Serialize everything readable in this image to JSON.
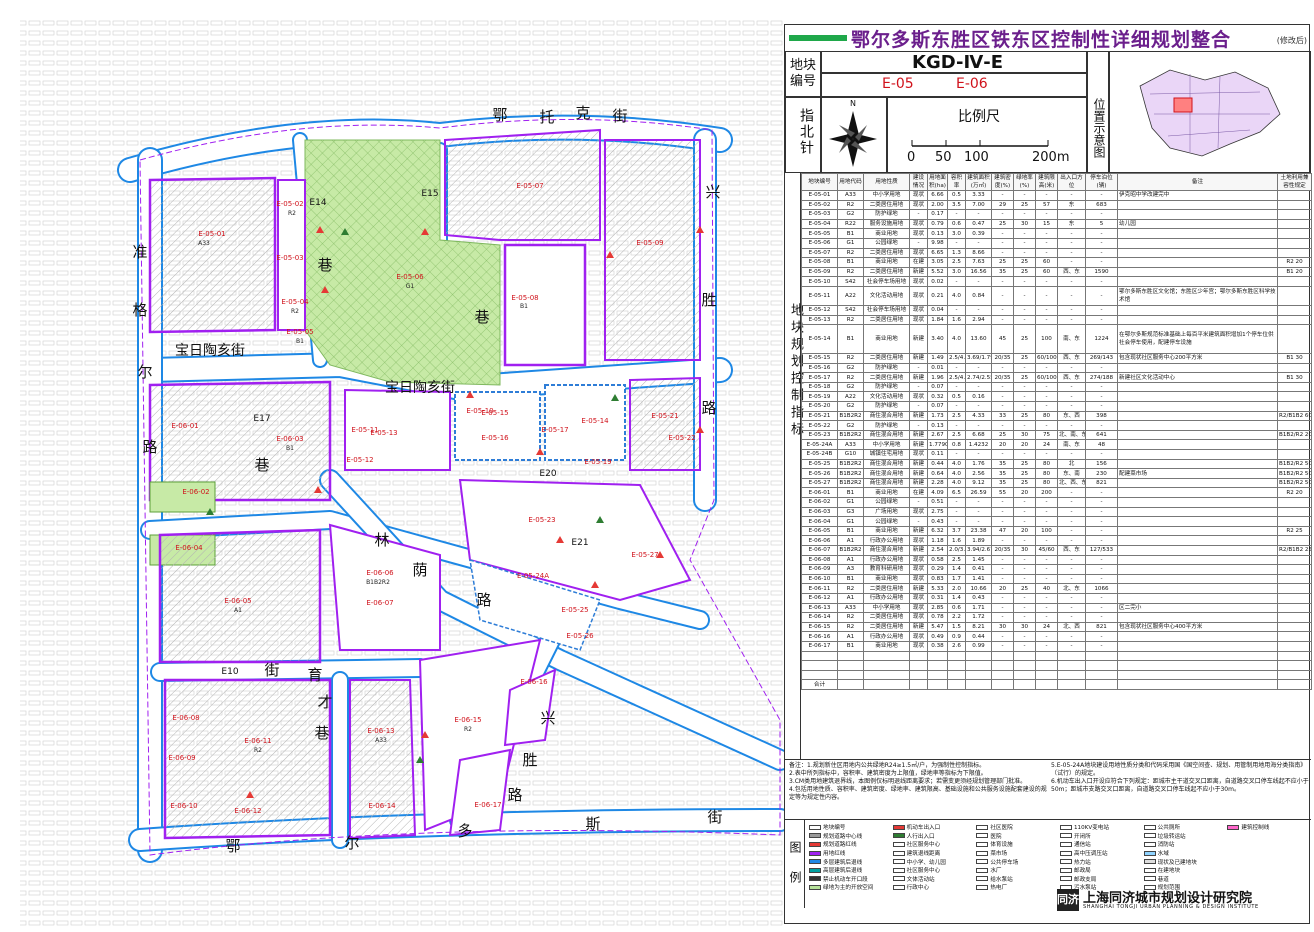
{
  "title": "鄂尔多斯东胜区铁东区控制性详细规划整合",
  "title_note": "(修改后)",
  "block_label": "地块编号",
  "plan_code": "KGD-Ⅳ-E",
  "block_codes": [
    "E-05",
    "E-06"
  ],
  "north_label": "指北针",
  "north_letter": "N",
  "scale_label": "比例尺",
  "scale_ticks": [
    "0",
    "50",
    "100",
    "200m"
  ],
  "location_label": "位置示意图",
  "side_label": "地块规划控制指标",
  "table": {
    "headers": [
      "地块编号",
      "用地代码",
      "用地性质",
      "建设情况",
      "用地面积(ha)",
      "容积率",
      "建筑面积(万㎡)",
      "建筑密度(%)",
      "绿地率(%)",
      "建筑限高(米)",
      "出入口方位",
      "停车泊位(辆)",
      "备注",
      "土地利用兼容性规定"
    ],
    "rows": [
      [
        "E-05-01",
        "A33",
        "中小学用地",
        "现状",
        "6.66",
        "0.5",
        "3.33",
        "-",
        "-",
        "-",
        "-",
        "-",
        "伊克昭中学改建完中",
        ""
      ],
      [
        "E-05-02",
        "R2",
        "二类居住用地",
        "现状",
        "2.00",
        "3.5",
        "7.00",
        "29",
        "25",
        "57",
        "东",
        "683",
        "",
        ""
      ],
      [
        "E-05-03",
        "G2",
        "防护绿地",
        "-",
        "0.17",
        "-",
        "-",
        "-",
        "-",
        "-",
        "-",
        "-",
        "",
        ""
      ],
      [
        "E-05-04",
        "R22",
        "服务设施用地",
        "现状",
        "0.79",
        "0.6",
        "0.47",
        "25",
        "30",
        "15",
        "东",
        "5",
        "幼儿园",
        ""
      ],
      [
        "E-05-05",
        "B1",
        "商业用地",
        "现状",
        "0.13",
        "3.0",
        "0.39",
        "-",
        "-",
        "-",
        "-",
        "-",
        "",
        ""
      ],
      [
        "E-05-06",
        "G1",
        "公园绿地",
        "-",
        "9.98",
        "-",
        "-",
        "-",
        "-",
        "-",
        "-",
        "-",
        "",
        ""
      ],
      [
        "E-05-07",
        "R2",
        "二类居住用地",
        "现状",
        "6.65",
        "1.3",
        "8.66",
        "-",
        "-",
        "-",
        "-",
        "-",
        "",
        ""
      ],
      [
        "E-05-08",
        "B1",
        "商业用地",
        "在建",
        "3.05",
        "2.5",
        "7.63",
        "25",
        "25",
        "60",
        "-",
        "-",
        "",
        "R2 20"
      ],
      [
        "E-05-09",
        "R2",
        "二类居住用地",
        "新建",
        "5.52",
        "3.0",
        "16.56",
        "35",
        "25",
        "60",
        "西、东",
        "1590",
        "",
        "B1 20"
      ],
      [
        "E-05-10",
        "S42",
        "社会停车场用地",
        "现状",
        "0.02",
        "-",
        "-",
        "-",
        "-",
        "-",
        "-",
        "-",
        "",
        ""
      ],
      [
        "E-05-11",
        "A22",
        "文化活动用地",
        "现状",
        "0.21",
        "4.0",
        "0.84",
        "-",
        "-",
        "-",
        "-",
        "-",
        "鄂尔多斯东胜区文化馆；东胜区少年宫；鄂尔多斯东胜区科学技术馆",
        ""
      ],
      [
        "E-05-12",
        "S42",
        "社会停车场用地",
        "现状",
        "0.04",
        "-",
        "-",
        "-",
        "-",
        "-",
        "-",
        "-",
        "",
        ""
      ],
      [
        "E-05-13",
        "R2",
        "二类居住用地",
        "现状",
        "1.84",
        "1.6",
        "2.94",
        "-",
        "-",
        "-",
        "-",
        "-",
        "",
        ""
      ],
      [
        "E-05-14",
        "B1",
        "商业用地",
        "新建",
        "3.40",
        "4.0",
        "13.60",
        "45",
        "25",
        "100",
        "南、东",
        "1224",
        "在鄂尔多斯规范标准基础上每百平米建筑面积增加1个停车位供社会停车使用，配建停车设施",
        ""
      ],
      [
        "E-05-15",
        "R2",
        "二类居住用地",
        "新建",
        "1.49",
        "2.5/4.0",
        "3.69/1.79",
        "20/35",
        "25",
        "60/100",
        "西、东",
        "269/143",
        "包含现状社区服务中心200平方米",
        "B1 30"
      ],
      [
        "E-05-16",
        "G2",
        "防护绿地",
        "-",
        "0.01",
        "-",
        "-",
        "-",
        "-",
        "-",
        "-",
        "-",
        "",
        ""
      ],
      [
        "E-05-17",
        "R2",
        "二类居住用地",
        "新建",
        "1.96",
        "2.5/4.0",
        "2.74/2.55",
        "20/35",
        "25",
        "60/100",
        "西、东",
        "274/188",
        "新建社区文化活动中心",
        "B1 30"
      ],
      [
        "E-05-18",
        "G2",
        "防护绿地",
        "-",
        "0.07",
        "-",
        "-",
        "-",
        "-",
        "-",
        "-",
        "-",
        "",
        ""
      ],
      [
        "E-05-19",
        "A22",
        "文化活动用地",
        "现状",
        "0.32",
        "0.5",
        "0.16",
        "-",
        "-",
        "-",
        "-",
        "-",
        "",
        ""
      ],
      [
        "E-05-20",
        "G2",
        "防护绿地",
        "-",
        "0.07",
        "-",
        "-",
        "-",
        "-",
        "-",
        "-",
        "-",
        "",
        ""
      ],
      [
        "E-05-21",
        "B1B2R2",
        "商住混合用地",
        "新建",
        "1.73",
        "2.5",
        "4.33",
        "33",
        "25",
        "80",
        "东、西",
        "398",
        "",
        "R2/B1B2 60/40"
      ],
      [
        "E-05-22",
        "G2",
        "防护绿地",
        "-",
        "0.13",
        "-",
        "-",
        "-",
        "-",
        "-",
        "-",
        "-",
        "",
        ""
      ],
      [
        "E-05-23",
        "B1B2R2",
        "商住混合用地",
        "新建",
        "2.67",
        "2.5",
        "6.68",
        "25",
        "30",
        "75",
        "北、南、东",
        "641",
        "",
        "B1B2/R2 20/80"
      ],
      [
        "E-05-24A",
        "A33",
        "中小学用地",
        "新建",
        "1.7790",
        "0.8",
        "1.4232",
        "20",
        "20",
        "24",
        "南、东",
        "48",
        "",
        ""
      ],
      [
        "E-05-24B",
        "G10",
        "城镇住宅用地",
        "现状",
        "0.11",
        "-",
        "-",
        "-",
        "-",
        "-",
        "-",
        "-",
        "",
        ""
      ],
      [
        "E-05-25",
        "B1B2R2",
        "商住混合用地",
        "新建",
        "0.44",
        "4.0",
        "1.76",
        "35",
        "25",
        "80",
        "北",
        "156",
        "",
        "B1B2/R2 50/50"
      ],
      [
        "E-05-26",
        "B1B2R2",
        "商住混合用地",
        "新建",
        "0.64",
        "4.0",
        "2.56",
        "35",
        "25",
        "80",
        "东、南",
        "230",
        "配建菜市场",
        "B1B2/R2 50/50"
      ],
      [
        "E-05-27",
        "B1B2R2",
        "商住混合用地",
        "新建",
        "2.28",
        "4.0",
        "9.12",
        "35",
        "25",
        "80",
        "北、西、东",
        "821",
        "",
        "B1B2/R2 50/50"
      ],
      [
        "E-06-01",
        "B1",
        "商业用地",
        "在建",
        "4.09",
        "6.5",
        "26.59",
        "55",
        "20",
        "200",
        "-",
        "-",
        "",
        "R2 20"
      ],
      [
        "E-06-02",
        "G1",
        "公园绿地",
        "-",
        "0.51",
        "-",
        "-",
        "-",
        "-",
        "-",
        "-",
        "-",
        "",
        ""
      ],
      [
        "E-06-03",
        "G3",
        "广场用地",
        "现状",
        "2.75",
        "-",
        "-",
        "-",
        "-",
        "-",
        "-",
        "-",
        "",
        ""
      ],
      [
        "E-06-04",
        "G1",
        "公园绿地",
        "-",
        "0.43",
        "-",
        "-",
        "-",
        "-",
        "-",
        "-",
        "-",
        "",
        ""
      ],
      [
        "E-06-05",
        "B1",
        "商业用地",
        "新建",
        "6.32",
        "3.7",
        "23.38",
        "47",
        "20",
        "100",
        "-",
        "-",
        "",
        "R2 25"
      ],
      [
        "E-06-06",
        "A1",
        "行政办公用地",
        "现状",
        "1.18",
        "1.6",
        "1.89",
        "-",
        "-",
        "-",
        "-",
        "-",
        "",
        ""
      ],
      [
        "E-06-07",
        "B1B2R2",
        "商住混合用地",
        "新建",
        "2.54",
        "2.0/3.0",
        "3.94/2.67",
        "20/35",
        "30",
        "45/60",
        "西、东",
        "127/533",
        "",
        "R2/B1B2 25/75"
      ],
      [
        "E-06-08",
        "A1",
        "行政办公用地",
        "现状",
        "0.58",
        "2.5",
        "1.45",
        "-",
        "-",
        "-",
        "-",
        "-",
        "",
        ""
      ],
      [
        "E-06-09",
        "A3",
        "教育科研用地",
        "现状",
        "0.29",
        "1.4",
        "0.41",
        "-",
        "-",
        "-",
        "-",
        "-",
        "",
        ""
      ],
      [
        "E-06-10",
        "B1",
        "商业用地",
        "现状",
        "0.83",
        "1.7",
        "1.41",
        "-",
        "-",
        "-",
        "-",
        "-",
        "",
        ""
      ],
      [
        "E-06-11",
        "R2",
        "二类居住用地",
        "新建",
        "5.33",
        "2.0",
        "10.66",
        "20",
        "25",
        "40",
        "北、东",
        "1066",
        "",
        ""
      ],
      [
        "E-06-12",
        "A1",
        "行政办公用地",
        "现状",
        "0.31",
        "1.4",
        "0.43",
        "-",
        "-",
        "-",
        "-",
        "-",
        "",
        ""
      ],
      [
        "E-06-13",
        "A33",
        "中小学用地",
        "现状",
        "2.85",
        "0.6",
        "1.71",
        "-",
        "-",
        "-",
        "-",
        "-",
        "区二完小",
        ""
      ],
      [
        "E-06-14",
        "R2",
        "二类居住用地",
        "现状",
        "0.78",
        "2.2",
        "1.72",
        "-",
        "-",
        "-",
        "-",
        "-",
        "",
        ""
      ],
      [
        "E-06-15",
        "R2",
        "二类居住用地",
        "新建",
        "5.47",
        "1.5",
        "8.21",
        "30",
        "30",
        "24",
        "北、西",
        "821",
        "包含现状社区服务中心400平方米",
        ""
      ],
      [
        "E-06-16",
        "A1",
        "行政办公用地",
        "现状",
        "0.49",
        "0.9",
        "0.44",
        "-",
        "-",
        "-",
        "-",
        "-",
        "",
        ""
      ],
      [
        "E-06-17",
        "B1",
        "商业用地",
        "现状",
        "0.38",
        "2.6",
        "0.99",
        "-",
        "-",
        "-",
        "-",
        "-",
        "",
        ""
      ]
    ],
    "total_label": "合计"
  },
  "notes": [
    "备注：1.规划新住区用地内公共绿地R24≥1.5㎡/户，为强制性控制指标。",
    "2.表中所列指标中，容积率、建筑密度为上限值，绿地率等指标为下限值。",
    "3.CM类用地建筑退界线，本图例仅标明退线距离要求；若需变更须经规划管理部门批准。",
    "4.包括用地性质、容积率、建筑密度、绿地率、建筑限高、基础设施和公共服务设施配套建设的规定等为规定性内容。",
    "5.E-05-24A地块建设用地性质分类和代码采用国《国空间查、规划、用管制用地用海分类指南》（试行）的规定。",
    "6.机动车出入口开设应符合下列规定：距城市主干道交叉口距离，自道路交叉口停车线起不应小于50m；距城市支路交叉口距离，自道路交叉口停车线起不应小于30m。"
  ],
  "legend_label": "图例",
  "legend": [
    {
      "label": "地块编号",
      "color": "#ffffff"
    },
    {
      "label": "机动车出入口",
      "color": "#e53935"
    },
    {
      "label": "社区医院",
      "color": "#ffffff"
    },
    {
      "label": "110KV变电站",
      "color": "#ffffff"
    },
    {
      "label": "公共厕所",
      "color": "#ffffff"
    },
    {
      "label": "建筑控制线",
      "color": "#ff66cc"
    },
    {
      "label": "规划道路中心线",
      "color": "#999999"
    },
    {
      "label": "人行出入口",
      "color": "#2e7d32"
    },
    {
      "label": "医院",
      "color": "#ffffff"
    },
    {
      "label": "开闭所",
      "color": "#ffffff"
    },
    {
      "label": "垃圾转运站",
      "color": "#ffffff"
    },
    {
      "label": "",
      "color": "#ffffff"
    },
    {
      "label": "规划道路红线",
      "color": "#e53935"
    },
    {
      "label": "社区服务中心",
      "color": "#ffffff"
    },
    {
      "label": "体育设施",
      "color": "#ffffff"
    },
    {
      "label": "通信站",
      "color": "#ffffff"
    },
    {
      "label": "消防站",
      "color": "#ffffff"
    },
    {
      "label": "",
      "color": "#ffffff"
    },
    {
      "label": "用地红线",
      "color": "#a020f0"
    },
    {
      "label": "建筑退线距离",
      "color": "#ffffff"
    },
    {
      "label": "菜市场",
      "color": "#ffffff"
    },
    {
      "label": "高中压调压站",
      "color": "#ffffff"
    },
    {
      "label": "水域",
      "color": "#8fd3ff"
    },
    {
      "label": "",
      "color": "#ffffff"
    },
    {
      "label": "多层建筑后退线",
      "color": "#1e88e5"
    },
    {
      "label": "中小学、幼儿园",
      "color": "#ffffff"
    },
    {
      "label": "公共停车场",
      "color": "#ffffff"
    },
    {
      "label": "热力站",
      "color": "#ffffff"
    },
    {
      "label": "现状及已建地块",
      "color": "#dddddd"
    },
    {
      "label": "",
      "color": "#ffffff"
    },
    {
      "label": "高层建筑后退线",
      "color": "#00a0a0"
    },
    {
      "label": "社区服务中心",
      "color": "#ffffff"
    },
    {
      "label": "水厂",
      "color": "#ffffff"
    },
    {
      "label": "邮政局",
      "color": "#ffffff"
    },
    {
      "label": "在建地块",
      "color": "#ffffff"
    },
    {
      "label": "",
      "color": "#ffffff"
    },
    {
      "label": "禁止机动车开口段",
      "color": "#333333"
    },
    {
      "label": "文体活动站",
      "color": "#ffffff"
    },
    {
      "label": "给水泵站",
      "color": "#ffffff"
    },
    {
      "label": "邮政支局",
      "color": "#ffffff"
    },
    {
      "label": "巷道",
      "color": "#ffffff"
    },
    {
      "label": "",
      "color": "#ffffff"
    },
    {
      "label": "绿地为主的开放空间",
      "color": "#b7e29b"
    },
    {
      "label": "行政中心",
      "color": "#ffffff"
    },
    {
      "label": "热电厂",
      "color": "#ffffff"
    },
    {
      "label": "污水泵站",
      "color": "#ffffff"
    },
    {
      "label": "规划范围",
      "color": "#ffffff"
    },
    {
      "label": "",
      "color": "#ffffff"
    }
  ],
  "institute": {
    "logo": "同济",
    "name_cn": "上海同济城市规划设计研究院",
    "name_en": "SHANGHAI TONGJI URBAN PLANNING & DESIGN INSTITUTE"
  },
  "map": {
    "streets": [
      "鄂",
      "托",
      "克",
      "街",
      "兴",
      "胜",
      "路",
      "准",
      "格",
      "尔",
      "路",
      "宝日陶亥街",
      "宝日陶亥街",
      "林",
      "荫",
      "路",
      "育",
      "才",
      "巷",
      "兴",
      "胜",
      "路",
      "鄂",
      "尔",
      "多",
      "斯",
      "街",
      "E14",
      "E15",
      "巷",
      "巷",
      "E17",
      "巷",
      "E20",
      "E21",
      "E10",
      "街"
    ],
    "blocks": [
      "E-05-01",
      "E-05-02",
      "E-05-03",
      "E-05-04",
      "E-05-05",
      "E-05-06",
      "E-05-07",
      "E-05-08",
      "E-05-09",
      "E-05-13",
      "E-05-11",
      "E-05-12",
      "E-05-10",
      "E-05-14",
      "E-05-15",
      "E-05-16",
      "E-05-17",
      "E-05-19",
      "E-05-21",
      "E-05-22",
      "E-05-23",
      "E-05-24A",
      "E-05-25",
      "E-05-26",
      "E-05-27",
      "E-06-01",
      "E-06-02",
      "E-06-03",
      "E-06-04",
      "E-06-05",
      "E-06-06",
      "E-06-07",
      "E-06-08",
      "E-06-09",
      "E-06-10",
      "E-06-11",
      "E-06-12",
      "E-06-13",
      "E-06-14",
      "E-06-15",
      "E-06-16",
      "E-06-17"
    ],
    "block_uses": [
      "A33",
      "R2",
      "G1",
      "R2",
      "B1",
      "B1",
      "B1",
      "A1",
      "B1B2R2",
      "R2",
      "A33",
      "R2"
    ]
  }
}
